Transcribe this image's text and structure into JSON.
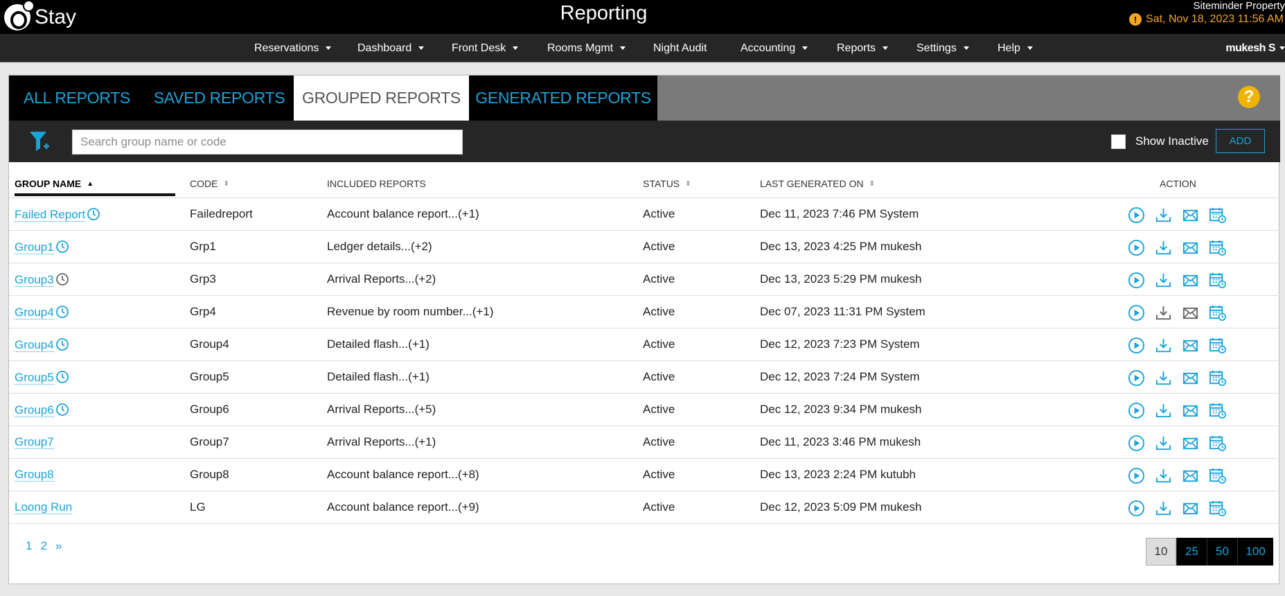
{
  "app": {
    "logo_text": "Stay",
    "title": "Reporting",
    "property": "Siteminder Property",
    "datetime": "Sat, Nov 18, 2023 11:56 AM",
    "user": "mukesh S"
  },
  "nav": [
    "Reservations",
    "Dashboard",
    "Front Desk",
    "Rooms Mgmt",
    "Night Audit",
    "Accounting",
    "Reports",
    "Settings",
    "Help"
  ],
  "tabs": [
    "ALL REPORTS",
    "SAVED REPORTS",
    "GROUPED REPORTS",
    "GENERATED REPORTS"
  ],
  "active_tab": "GROUPED REPORTS",
  "toolbar": {
    "search_placeholder": "Search group name or code",
    "show_inactive_label": "Show Inactive",
    "add_label": "ADD"
  },
  "columns": [
    "GROUP NAME",
    "CODE",
    "INCLUDED REPORTS",
    "STATUS",
    "LAST GENERATED ON",
    "ACTION"
  ],
  "rows": [
    {
      "name": "Failed Report",
      "scheduled": true,
      "code": "Failedreport",
      "reports": "Account balance report...(+1)",
      "status": "Active",
      "last": "Dec 11, 2023 7:46 PM System"
    },
    {
      "name": "Group1",
      "scheduled": true,
      "code": "Grp1",
      "reports": "Ledger details...(+2)",
      "status": "Active",
      "last": "Dec 13, 2023 4:25 PM mukesh"
    },
    {
      "name": "Group3",
      "scheduled": false,
      "code": "Grp3",
      "reports": "Arrival Reports...(+2)",
      "status": "Active",
      "last": "Dec 13, 2023 5:29 PM mukesh"
    },
    {
      "name": "Group4",
      "scheduled": true,
      "code": "Grp4",
      "reports": "Revenue by room number...(+1)",
      "status": "Active",
      "last": "Dec 07, 2023 11:31 PM System"
    },
    {
      "name": "Group4",
      "scheduled": true,
      "code": "Group4",
      "reports": "Detailed flash...(+1)",
      "status": "Active",
      "last": "Dec 12, 2023 7:23 PM System"
    },
    {
      "name": "Group5",
      "scheduled": true,
      "code": "Group5",
      "reports": "Detailed flash...(+1)",
      "status": "Active",
      "last": "Dec 12, 2023 7:24 PM System"
    },
    {
      "name": "Group6",
      "scheduled": true,
      "code": "Group6",
      "reports": "Arrival Reports...(+5)",
      "status": "Active",
      "last": "Dec 12, 2023 9:34 PM mukesh"
    },
    {
      "name": "Group7",
      "scheduled": null,
      "code": "Group7",
      "reports": "Arrival Reports...(+1)",
      "status": "Active",
      "last": "Dec 11, 2023 3:46 PM mukesh"
    },
    {
      "name": "Group8",
      "scheduled": null,
      "code": "Group8",
      "reports": "Account balance report...(+8)",
      "status": "Active",
      "last": "Dec 13, 2023 2:24 PM kutubh"
    },
    {
      "name": "Loong Run",
      "scheduled": null,
      "code": "LG",
      "reports": "Account balance report...(+9)",
      "status": "Active",
      "last": "Dec 12, 2023 5:09 PM mukesh"
    }
  ],
  "pagination": {
    "pages": [
      "1",
      "2",
      "»"
    ],
    "current": "1",
    "page_sizes": [
      "10",
      "25",
      "50",
      "100"
    ],
    "page_size": "10"
  },
  "colors": {
    "accent": "#1aa3d9",
    "warning": "#f5a623",
    "help": "#f0b400",
    "disabled": "#666666"
  }
}
